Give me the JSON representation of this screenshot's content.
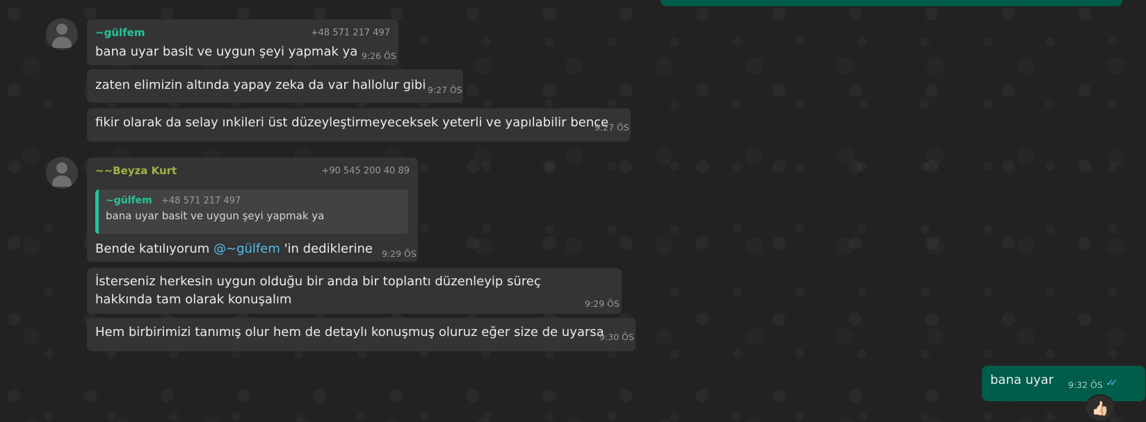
{
  "chat": {
    "group1": {
      "sender": "~gülfem",
      "phone": "+48 571 217 497",
      "messages": [
        {
          "text": "bana uyar basit ve uygun şeyi yapmak ya",
          "time": "9:26 ÖS"
        },
        {
          "text": "zaten elimizin altında yapay zeka da var hallolur gibi",
          "time": "9:27 ÖS"
        },
        {
          "text": "fikir olarak da selay ınkileri üst düzeyleştirmeyeceksek yeterli ve yapılabilir bence",
          "time": "9:27 ÖS"
        }
      ]
    },
    "group2": {
      "sender": "~~Beyza Kurt",
      "phone": "+90 545 200 40 89",
      "quote": {
        "sender": "~gülfem",
        "phone": "+48 571 217 497",
        "text": "bana uyar basit ve uygun şeyi yapmak ya"
      },
      "reply": {
        "before": "Bende katılıyorum ",
        "mention": "@~gülfem",
        "after": " 'in dediklerine",
        "time": "9:29 ÖS"
      },
      "messages": [
        {
          "text": "İsterseniz herkesin uygun olduğu bir anda bir toplantı düzenleyip süreç hakkında tam olarak konuşalım",
          "time": "9:29 ÖS"
        },
        {
          "text": "Hem birbirimizi tanımış olur hem de detaylı konuşmuş oluruz eğer size de uyarsa",
          "time": "9:30 ÖS"
        }
      ]
    },
    "outgoing": {
      "text": "bana uyar",
      "time": "9:32 ÖS",
      "status_icon": "double-check-read-icon",
      "reaction": "👍🏻"
    }
  },
  "colors": {
    "background": "#222222",
    "incoming_bubble": "#343434",
    "outgoing_bubble": "#005c4b",
    "sender_green": "#25c59a",
    "sender_olive": "#a3b245",
    "mention": "#53bdeb"
  }
}
